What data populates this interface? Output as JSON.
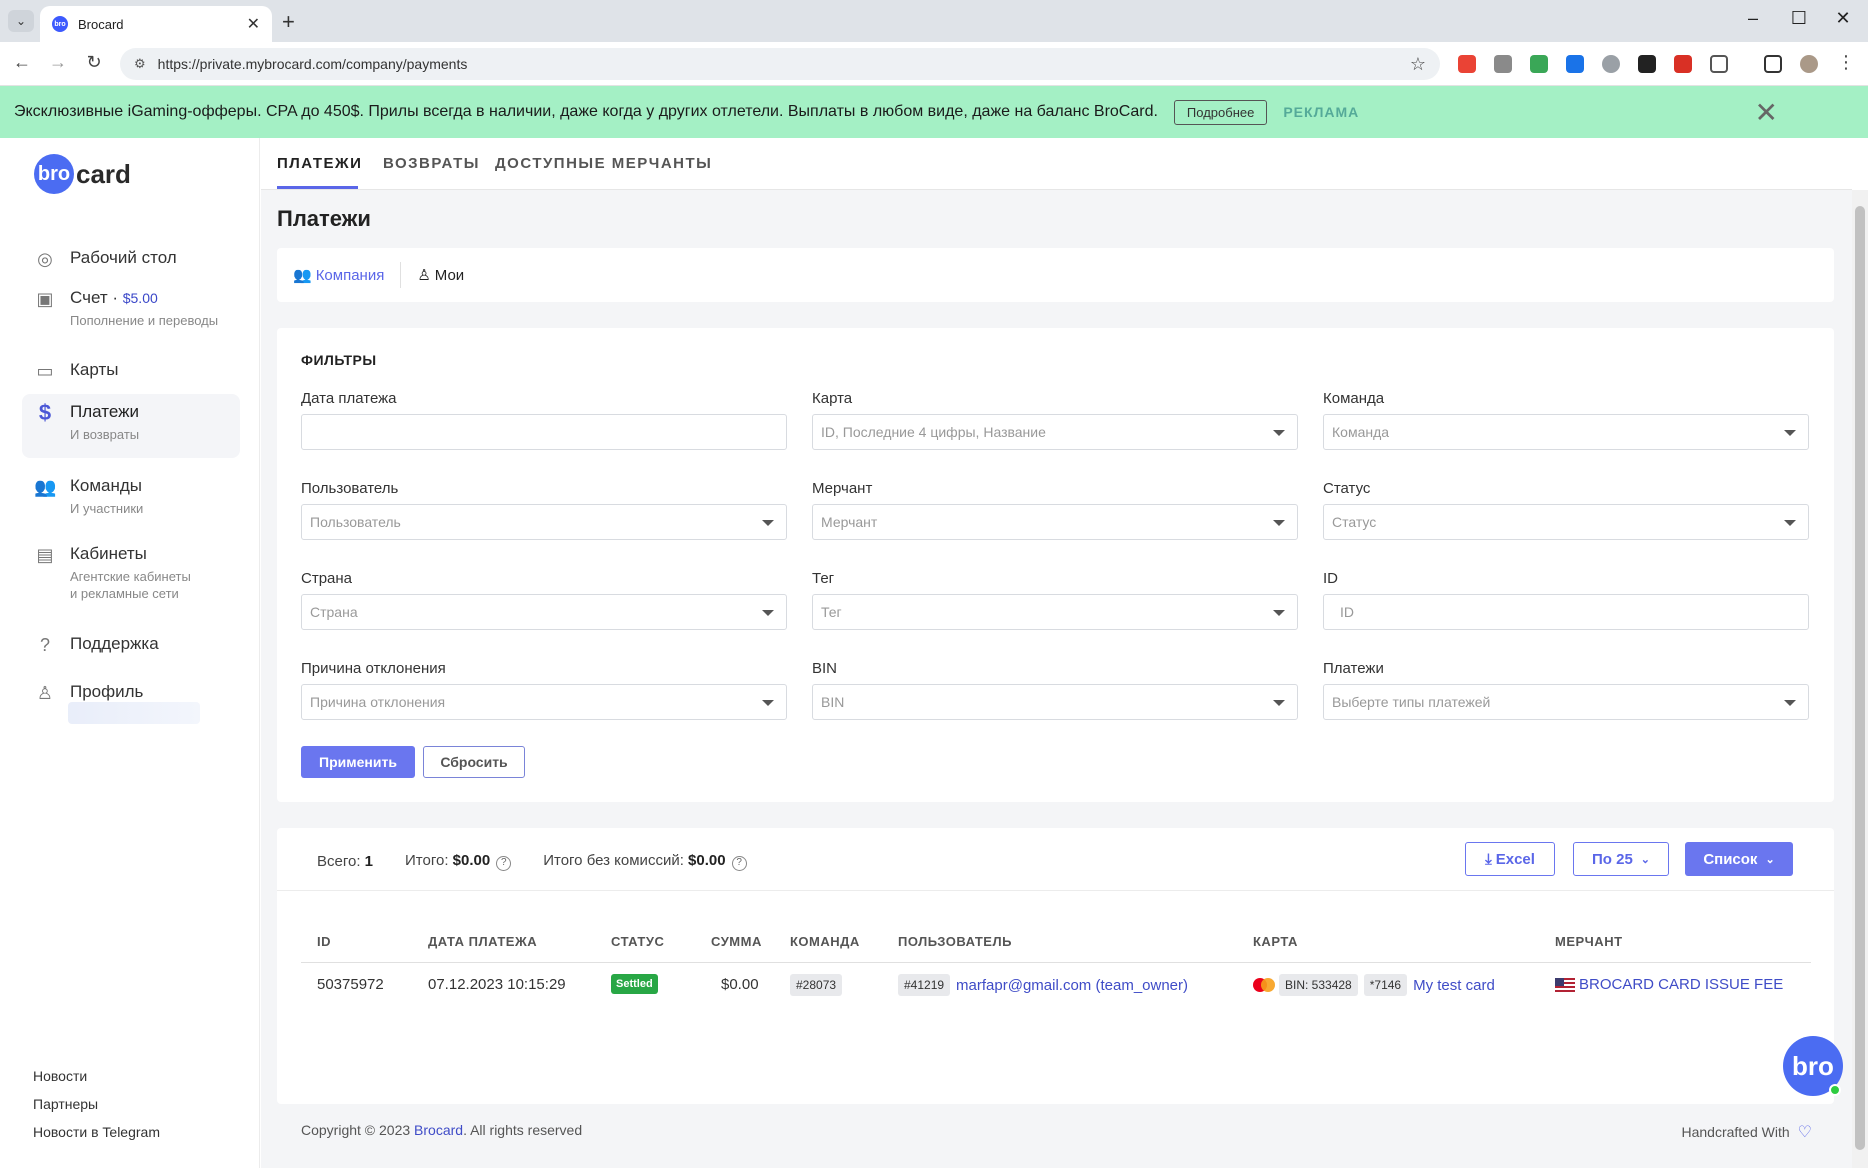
{
  "browser": {
    "tab_title": "Brocard",
    "favicon_text": "bro",
    "new_tab": "+",
    "url": "https://private.mybrocard.com/company/payments",
    "window_minimize": "–",
    "window_maximize": "☐",
    "window_close": "✕"
  },
  "ad": {
    "text": "Эксклюзивные iGaming-офферы. CPA до 450$. Прилы всегда в наличии, даже когда у других отлетели. Выплаты в любом виде, даже на баланс BroCard.",
    "button": "Подробнее",
    "label": "РЕКЛАМА",
    "close": "✕"
  },
  "sidebar": {
    "logo_circle": "bro",
    "logo_text": "card",
    "items": [
      {
        "label": "Рабочий стол",
        "sub": "",
        "icon": "bro-circle-icon"
      },
      {
        "label": "Счет · ",
        "amount": "$5.00",
        "sub": "Пополнение и переводы",
        "icon": "wallet-icon"
      },
      {
        "label": "Карты",
        "sub": "",
        "icon": "card-icon"
      },
      {
        "label": "Платежи",
        "sub": "И возвраты",
        "icon": "dollar-icon",
        "active": true
      },
      {
        "label": "Команды",
        "sub": "И участники",
        "icon": "users-icon"
      },
      {
        "label": "Кабинеты",
        "sub": "Агентские кабинеты",
        "sub2": "и рекламные сети",
        "icon": "briefcase-icon"
      },
      {
        "label": "Поддержка",
        "sub": "",
        "icon": "help-icon"
      },
      {
        "label": "Профиль",
        "sub": "",
        "icon": "user-icon"
      }
    ],
    "bottom_links": [
      "Новости",
      "Партнеры",
      "Новости в Telegram"
    ]
  },
  "main": {
    "tabs": [
      "ПЛАТЕЖИ",
      "ВОЗВРАТЫ",
      "ДОСТУПНЫЕ МЕРЧАНТЫ"
    ],
    "page_title": "Платежи",
    "scope": {
      "company": "Компания",
      "mine": "Мои"
    },
    "filters": {
      "title": "ФИЛЬТРЫ",
      "fields": [
        {
          "label": "Дата платежа",
          "placeholder": ""
        },
        {
          "label": "Карта",
          "placeholder": "ID, Последние 4 цифры, Название"
        },
        {
          "label": "Команда",
          "placeholder": "Команда"
        },
        {
          "label": "Пользователь",
          "placeholder": "Пользователь"
        },
        {
          "label": "Мерчант",
          "placeholder": "Мерчант"
        },
        {
          "label": "Статус",
          "placeholder": "Статус"
        },
        {
          "label": "Страна",
          "placeholder": "Страна"
        },
        {
          "label": "Тег",
          "placeholder": "Тег"
        },
        {
          "label": "ID",
          "placeholder": "ID"
        },
        {
          "label": "Причина отклонения",
          "placeholder": "Причина отклонения"
        },
        {
          "label": "BIN",
          "placeholder": "BIN"
        },
        {
          "label": "Платежи",
          "placeholder": "Выберте типы платежей"
        }
      ],
      "apply": "Применить",
      "reset": "Сбросить"
    },
    "results": {
      "total_label": "Всего:",
      "total_value": "1",
      "sum_label": "Итого:",
      "sum_value": "$0.00",
      "sum_nocomm_label": "Итого без комиссий:",
      "sum_nocomm_value": "$0.00",
      "excel": "Excel",
      "per_page": "По 25",
      "view": "Список",
      "columns": [
        "ID",
        "ДАТА ПЛАТЕЖА",
        "СТАТУС",
        "СУММА",
        "КОМАНДА",
        "ПОЛЬЗОВАТЕЛЬ",
        "КАРТА",
        "МЕРЧАНТ"
      ],
      "rows": [
        {
          "id": "50375972",
          "date": "07.12.2023 10:15:29",
          "status": "Settled",
          "amount": "$0.00",
          "team": "#28073",
          "user_id": "#41219",
          "user": "marfapr@gmail.com (team_owner)",
          "bin": "BIN: 533428",
          "last4": "*7146",
          "card_name": "My test card",
          "merchant": "BROCARD CARD ISSUE FEE"
        }
      ]
    },
    "footer": {
      "copyright_pre": "Copyright © 2023 ",
      "copyright_link": "Brocard",
      "copyright_post": ". All rights reserved",
      "handcrafted": "Handcrafted With"
    },
    "chat_bubble": "bro"
  },
  "colors": {
    "accent": "#6a76ef",
    "ad_bg": "#a4f0c5",
    "status_settled": "#28a745"
  }
}
